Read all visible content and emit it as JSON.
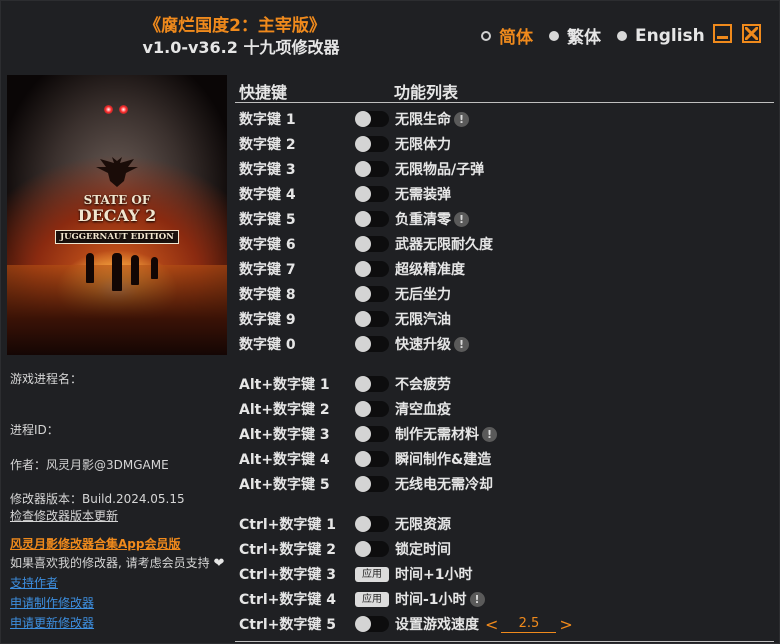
{
  "header": {
    "title": "《腐烂国度2：主宰版》",
    "subtitle": "v1.0-v36.2 十九项修改器"
  },
  "languages": [
    {
      "label": "简体",
      "selected": true
    },
    {
      "label": "繁体",
      "selected": false
    },
    {
      "label": "English",
      "selected": false
    }
  ],
  "window_controls": {
    "minimize": "minimize-icon",
    "close": "close-icon"
  },
  "accent_color": "#f08a1c",
  "cover": {
    "title_line1": "STATE OF",
    "title_line2": "DECAY 2",
    "edition": "JUGGERNAUT EDITION"
  },
  "sidebar": {
    "process_name_label": "游戏进程名：",
    "process_id_label": "进程ID：",
    "author": "作者：风灵月影@3DMGAME",
    "version": "修改器版本：Build.2024.05.15",
    "check_update": "检查修改器版本更新",
    "app_promo": "风灵月影修改器合集App会员版",
    "support_text": "如果喜欢我的修改器, 请考虑会员支持",
    "support_author": "支持作者",
    "request_trainer": "申请制作修改器",
    "request_update": "申请更新修改器"
  },
  "table": {
    "col_hotkey": "快捷键",
    "col_features": "功能列表",
    "apply_label": "应用",
    "rows": [
      {
        "hotkey": "数字键 1",
        "feature": "无限生命",
        "control": "toggle",
        "warn": true
      },
      {
        "hotkey": "数字键 2",
        "feature": "无限体力",
        "control": "toggle",
        "warn": false
      },
      {
        "hotkey": "数字键 3",
        "feature": "无限物品/子弹",
        "control": "toggle",
        "warn": false
      },
      {
        "hotkey": "数字键 4",
        "feature": "无需装弹",
        "control": "toggle",
        "warn": false
      },
      {
        "hotkey": "数字键 5",
        "feature": "负重清零",
        "control": "toggle",
        "warn": true
      },
      {
        "hotkey": "数字键 6",
        "feature": "武器无限耐久度",
        "control": "toggle",
        "warn": false
      },
      {
        "hotkey": "数字键 7",
        "feature": "超级精准度",
        "control": "toggle",
        "warn": false
      },
      {
        "hotkey": "数字键 8",
        "feature": "无后坐力",
        "control": "toggle",
        "warn": false
      },
      {
        "hotkey": "数字键 9",
        "feature": "无限汽油",
        "control": "toggle",
        "warn": false
      },
      {
        "hotkey": "数字键 0",
        "feature": "快速升级",
        "control": "toggle",
        "warn": true
      },
      {
        "hotkey": "Alt+数字键 1",
        "feature": "不会疲劳",
        "control": "toggle",
        "warn": false
      },
      {
        "hotkey": "Alt+数字键 2",
        "feature": "清空血疫",
        "control": "toggle",
        "warn": false
      },
      {
        "hotkey": "Alt+数字键 3",
        "feature": "制作无需材料",
        "control": "toggle",
        "warn": true
      },
      {
        "hotkey": "Alt+数字键 4",
        "feature": "瞬间制作&建造",
        "control": "toggle",
        "warn": false
      },
      {
        "hotkey": "Alt+数字键 5",
        "feature": "无线电无需冷却",
        "control": "toggle",
        "warn": false
      },
      {
        "hotkey": "Ctrl+数字键 1",
        "feature": "无限资源",
        "control": "toggle",
        "warn": false
      },
      {
        "hotkey": "Ctrl+数字键 2",
        "feature": "锁定时间",
        "control": "toggle",
        "warn": false
      },
      {
        "hotkey": "Ctrl+数字键 3",
        "feature": "时间+1小时",
        "control": "apply",
        "warn": false
      },
      {
        "hotkey": "Ctrl+数字键 4",
        "feature": "时间-1小时",
        "control": "apply",
        "warn": true
      },
      {
        "hotkey": "Ctrl+数字键 5",
        "feature": "设置游戏速度",
        "control": "toggle",
        "warn": false,
        "value": "2.5"
      }
    ]
  },
  "speed": {
    "left_arrow": "<",
    "right_arrow": ">",
    "value": "2.5"
  },
  "warn_glyph": "!",
  "heart_glyph": "❤"
}
